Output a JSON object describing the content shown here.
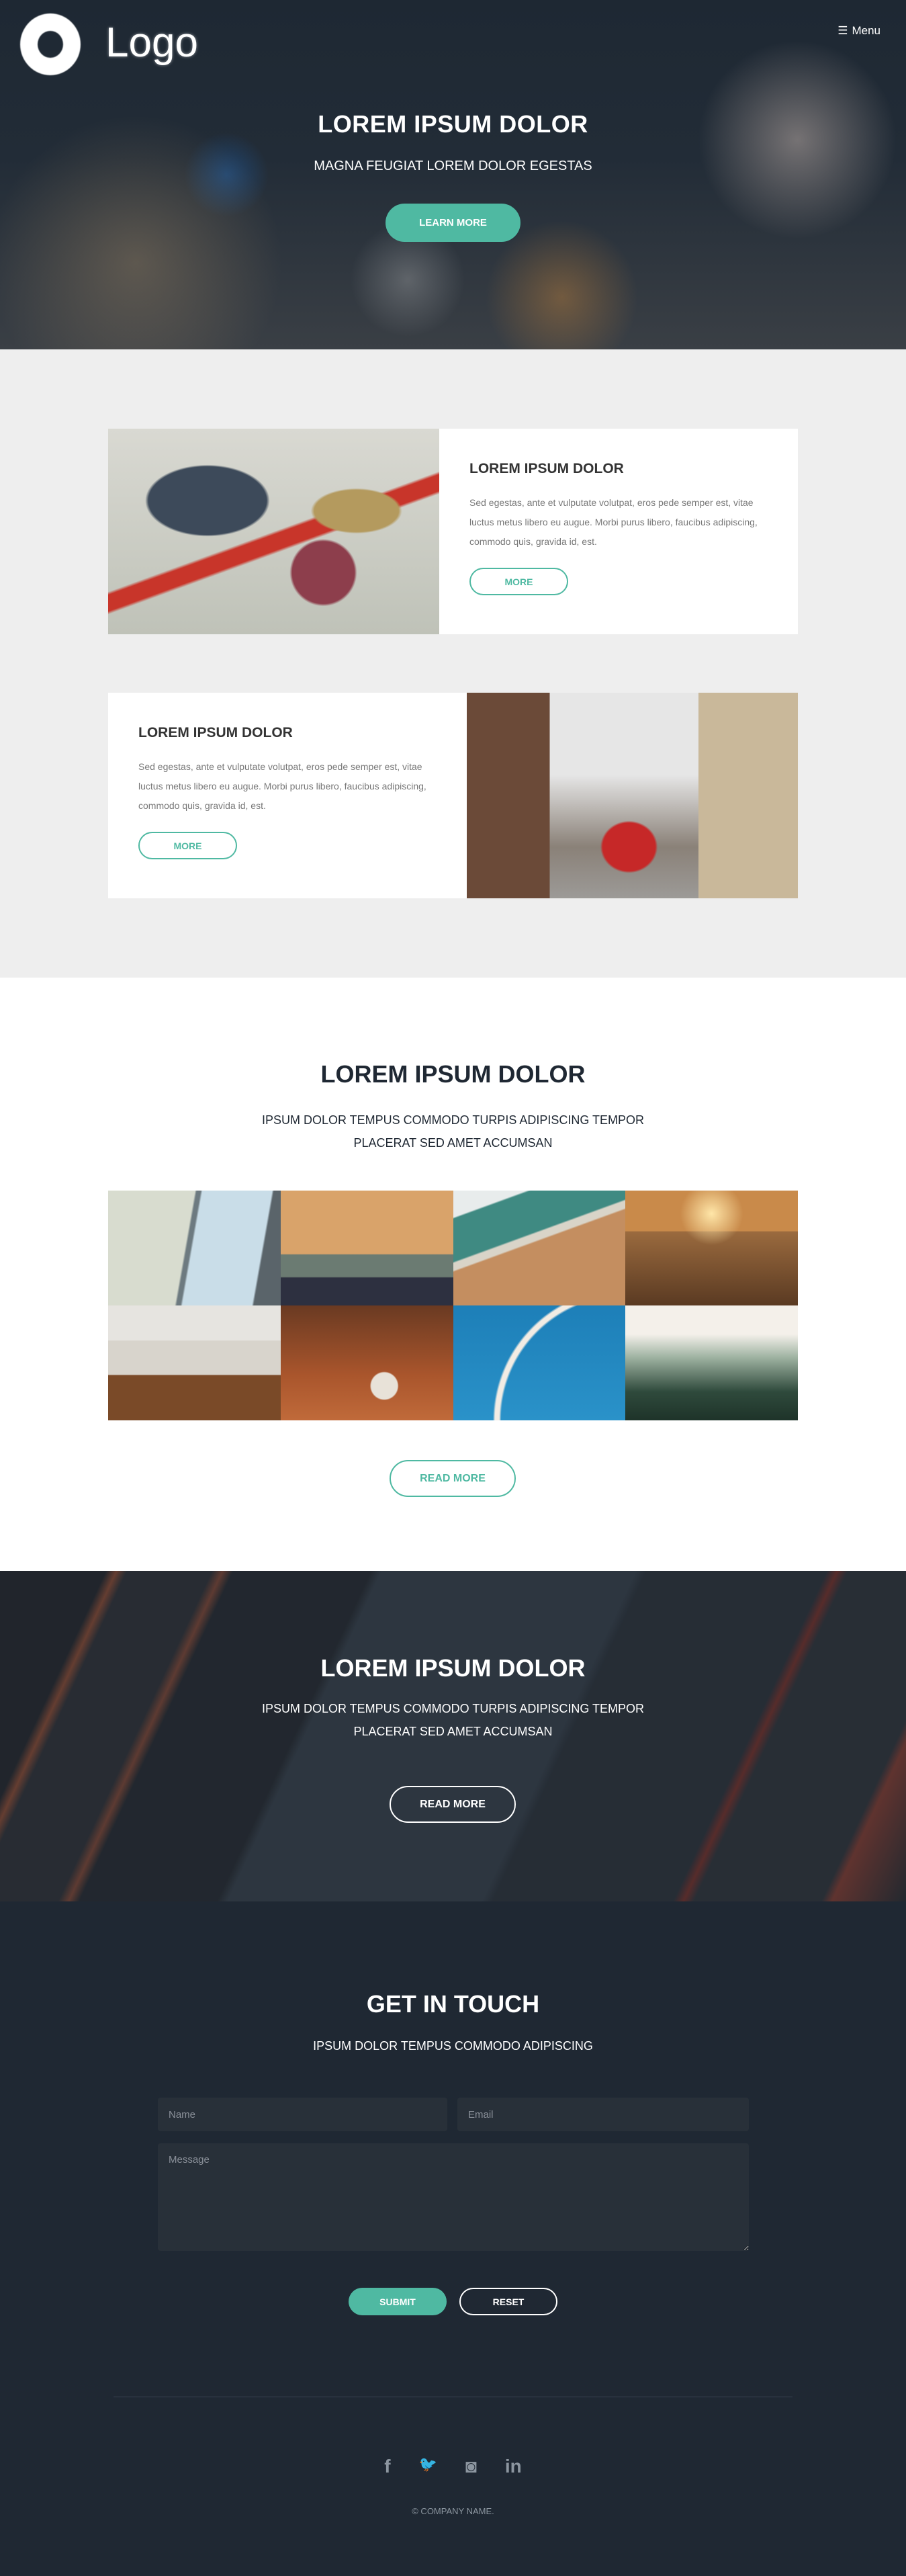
{
  "header": {
    "logo_text": "Logo",
    "menu_label": "Menu"
  },
  "hero": {
    "title": "LOREM IPSUM DOLOR",
    "subtitle": "MAGNA FEUGIAT LOREM DOLOR EGESTAS",
    "button": "LEARN MORE"
  },
  "features": [
    {
      "title": "LOREM IPSUM DOLOR",
      "text": "Sed egestas, ante et vulputate volutpat, eros pede semper est, vitae luctus metus libero eu augue. Morbi purus libero, faucibus adipiscing, commodo quis, gravida id, est.",
      "button": "MORE"
    },
    {
      "title": "LOREM IPSUM DOLOR",
      "text": "Sed egestas, ante et vulputate volutpat, eros pede semper est, vitae luctus metus libero eu augue. Morbi purus libero, faucibus adipiscing, commodo quis, gravida id, est.",
      "button": "MORE"
    }
  ],
  "gallery": {
    "title": "LOREM IPSUM DOLOR",
    "subtitle_line1": "IPSUM DOLOR TEMPUS COMMODO TURPIS ADIPISCING TEMPOR",
    "subtitle_line2": "PLACERAT SED AMET ACCUMSAN",
    "button": "READ MORE"
  },
  "banner": {
    "title": "LOREM IPSUM DOLOR",
    "subtitle_line1": "IPSUM DOLOR TEMPUS COMMODO TURPIS ADIPISCING TEMPOR",
    "subtitle_line2": "PLACERAT SED AMET ACCUMSAN",
    "button": "READ MORE"
  },
  "contact": {
    "title": "GET IN TOUCH",
    "subtitle": "IPSUM DOLOR TEMPUS COMMODO ADIPISCING",
    "name_placeholder": "Name",
    "email_placeholder": "Email",
    "message_placeholder": "Message",
    "submit": "SUBMIT",
    "reset": "RESET"
  },
  "footer": {
    "social": [
      {
        "icon": "facebook-icon",
        "glyph": "f"
      },
      {
        "icon": "twitter-icon",
        "glyph": "🐦"
      },
      {
        "icon": "instagram-icon",
        "glyph": "◙"
      },
      {
        "icon": "linkedin-icon",
        "glyph": "in"
      }
    ],
    "copyright": "© COMPANY NAME."
  },
  "colors": {
    "accent": "#4fb9a2",
    "dark": "#1f2833",
    "light_bg": "#eeeeee"
  }
}
